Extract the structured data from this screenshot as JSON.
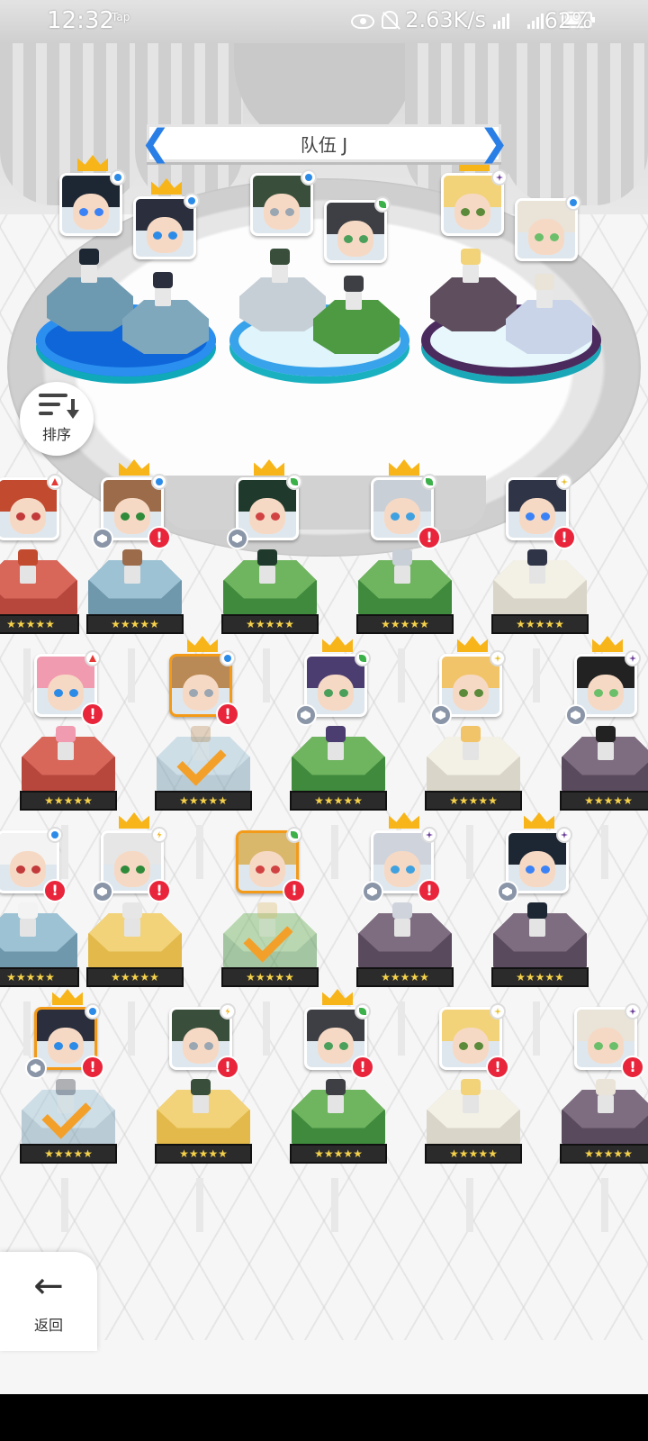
{
  "status_bar": {
    "time": "12:32",
    "tap": "Tap",
    "net_speed": "2.63K/s",
    "signal1": "4G",
    "signal2": "5G",
    "battery": "62%"
  },
  "team": {
    "title": "队伍 J",
    "members": [
      {
        "element": "water",
        "crowned": true
      },
      {
        "element": "water",
        "crowned": true
      },
      {
        "element": "water",
        "crowned": false
      },
      {
        "element": "wind",
        "crowned": false
      },
      {
        "element": "shadow",
        "crowned": true
      },
      {
        "element": "water",
        "crowned": false
      }
    ]
  },
  "sort_button": {
    "label": "排序"
  },
  "back_button": {
    "label": "返回"
  },
  "colors": {
    "accent_blue": "#2a7fe6",
    "alert_red": "#e8253b",
    "selected_orange": "#f39a18",
    "crown_gold": "#f7b519"
  },
  "roster": [
    {
      "element": "fire",
      "crowned": false,
      "alert": false,
      "rank": false
    },
    {
      "element": "water",
      "crowned": true,
      "alert": true,
      "rank": true
    },
    {
      "element": "wind",
      "crowned": true,
      "alert": false,
      "rank": true
    },
    {
      "element": "wind",
      "crowned": true,
      "alert": true,
      "rank": false
    },
    {
      "element": "light",
      "crowned": false,
      "alert": true,
      "rank": false
    },
    {
      "element": "fire",
      "crowned": false,
      "alert": true,
      "rank": false
    },
    {
      "element": "water",
      "crowned": true,
      "alert": true,
      "rank": false,
      "selected": true,
      "in_team": true
    },
    {
      "element": "wind",
      "crowned": true,
      "alert": false,
      "rank": true
    },
    {
      "element": "light",
      "crowned": true,
      "alert": false,
      "rank": true
    },
    {
      "element": "shadow",
      "crowned": true,
      "alert": false,
      "rank": true
    },
    {
      "element": "water",
      "crowned": false,
      "alert": true,
      "rank": false
    },
    {
      "element": "thunder",
      "crowned": true,
      "alert": true,
      "rank": true
    },
    {
      "element": "wind",
      "crowned": false,
      "alert": true,
      "rank": false,
      "selected": true,
      "in_team": true
    },
    {
      "element": "shadow",
      "crowned": true,
      "alert": true,
      "rank": true
    },
    {
      "element": "shadow",
      "crowned": true,
      "alert": false,
      "rank": true
    },
    {
      "element": "water",
      "crowned": true,
      "alert": true,
      "rank": true,
      "selected": true,
      "in_team": true
    },
    {
      "element": "thunder",
      "crowned": false,
      "alert": true,
      "rank": false
    },
    {
      "element": "wind",
      "crowned": true,
      "alert": true,
      "rank": false
    },
    {
      "element": "light",
      "crowned": false,
      "alert": true,
      "rank": false
    },
    {
      "element": "shadow",
      "crowned": false,
      "alert": true,
      "rank": false
    }
  ],
  "star_rating": "★★★★★"
}
